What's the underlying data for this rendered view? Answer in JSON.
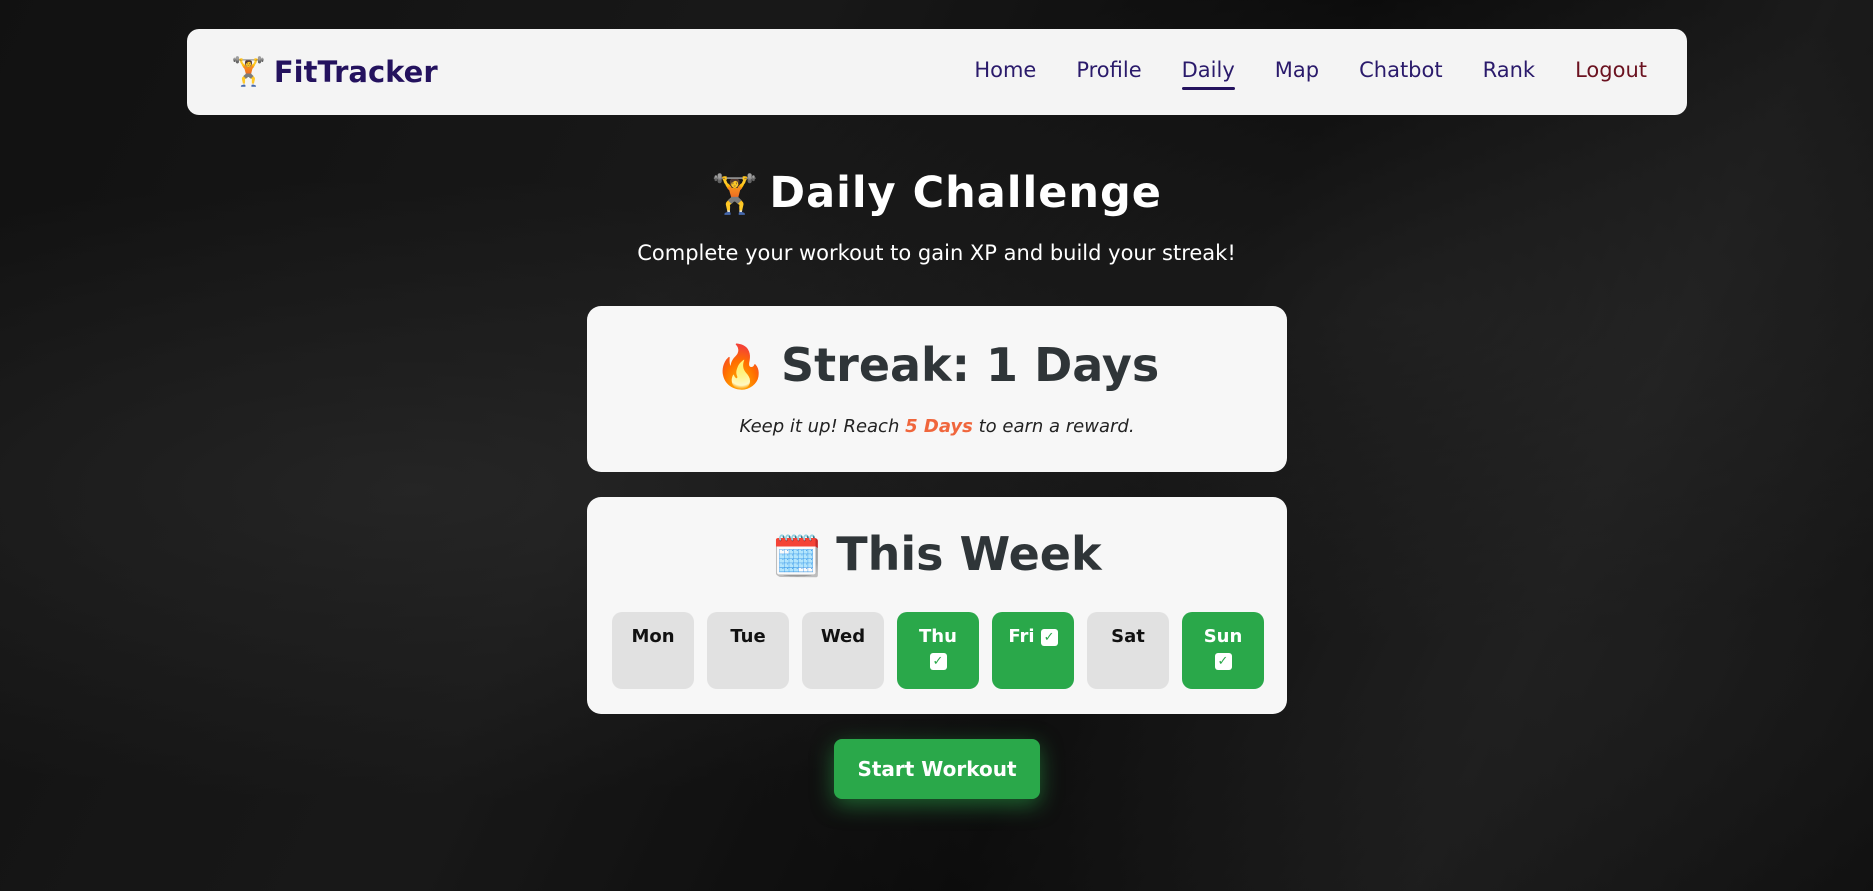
{
  "colors": {
    "accent": "#24125e",
    "logout": "#6b1220",
    "success": "#2aa84a",
    "highlight": "#f0663c"
  },
  "nav": {
    "brand_icon": "🏋️",
    "brand": "FitTracker",
    "links": [
      {
        "label": "Home"
      },
      {
        "label": "Profile"
      },
      {
        "label": "Daily",
        "active": true
      },
      {
        "label": "Map"
      },
      {
        "label": "Chatbot"
      },
      {
        "label": "Rank"
      },
      {
        "label": "Logout"
      }
    ]
  },
  "header": {
    "icon": "🏋️",
    "title": "Daily Challenge",
    "subtitle": "Complete your workout to gain XP and build your streak!"
  },
  "streak": {
    "icon": "🔥",
    "title": "Streak: 1 Days",
    "note_prefix": "Keep it up! Reach ",
    "note_highlight": "5 Days",
    "note_suffix": " to earn a reward."
  },
  "week": {
    "icon": "🗓️",
    "title": "This Week",
    "days": [
      {
        "label": "Mon",
        "done": false
      },
      {
        "label": "Tue",
        "done": false
      },
      {
        "label": "Wed",
        "done": false
      },
      {
        "label": "Thu",
        "done": true
      },
      {
        "label": "Fri",
        "done": true
      },
      {
        "label": "Sat",
        "done": false
      },
      {
        "label": "Sun",
        "done": true
      }
    ],
    "check_icon": "✓"
  },
  "actions": {
    "start_label": "Start Workout"
  }
}
